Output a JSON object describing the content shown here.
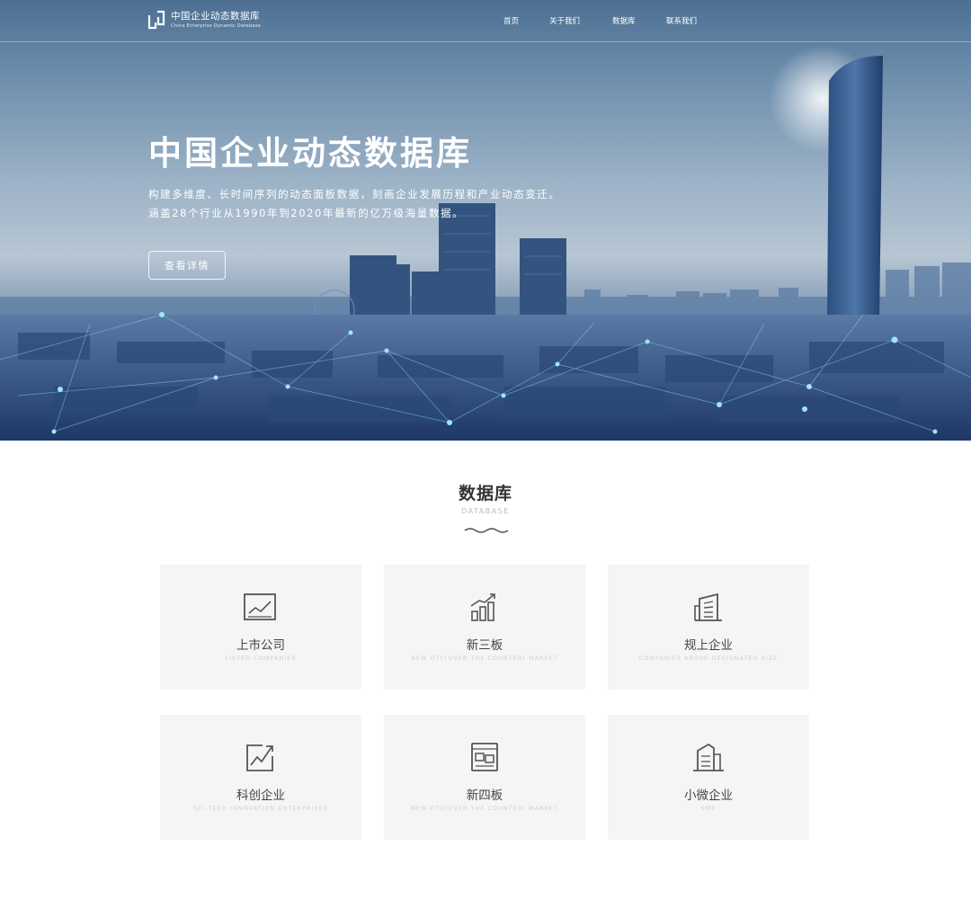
{
  "header": {
    "logo_title": "中国企业动态数据库",
    "logo_subtitle": "China Enterprise Dynamic Database",
    "nav": [
      "首页",
      "关于我们",
      "数据库",
      "联系我们"
    ]
  },
  "hero": {
    "title": "中国企业动态数据库",
    "desc_line1": "构建多维度、长时间序列的动态面板数据，刻画企业发展历程和产业动态变迁。",
    "desc_line2": "涵盖28个行业从1990年到2020年最新的亿万级海量数据。",
    "button": "查看详情"
  },
  "database": {
    "title": "数据库",
    "subtitle": "DATABASE",
    "cards": [
      {
        "name": "上市公司",
        "sub": "LISTED COMPANIES",
        "icon": "line-chart-icon"
      },
      {
        "name": "新三板",
        "sub": "NEW OTC(OVER THE COUNTER) MARKET",
        "icon": "bar-growth-icon"
      },
      {
        "name": "规上企业",
        "sub": "COMPANIES ABOVE DESIGNATED SIZE",
        "icon": "building-icon"
      },
      {
        "name": "科创企业",
        "sub": "SCI-TECH INNOVATION ENTERPRISES",
        "icon": "trend-up-icon"
      },
      {
        "name": "新四板",
        "sub": "NEW OTC(OVER THE COUNTER) MARKET",
        "icon": "board-icon"
      },
      {
        "name": "小微企业",
        "sub": "SME",
        "icon": "small-building-icon"
      }
    ]
  },
  "colors": {
    "accent": "#3a5f8f",
    "card_bg": "#f5f5f5"
  }
}
